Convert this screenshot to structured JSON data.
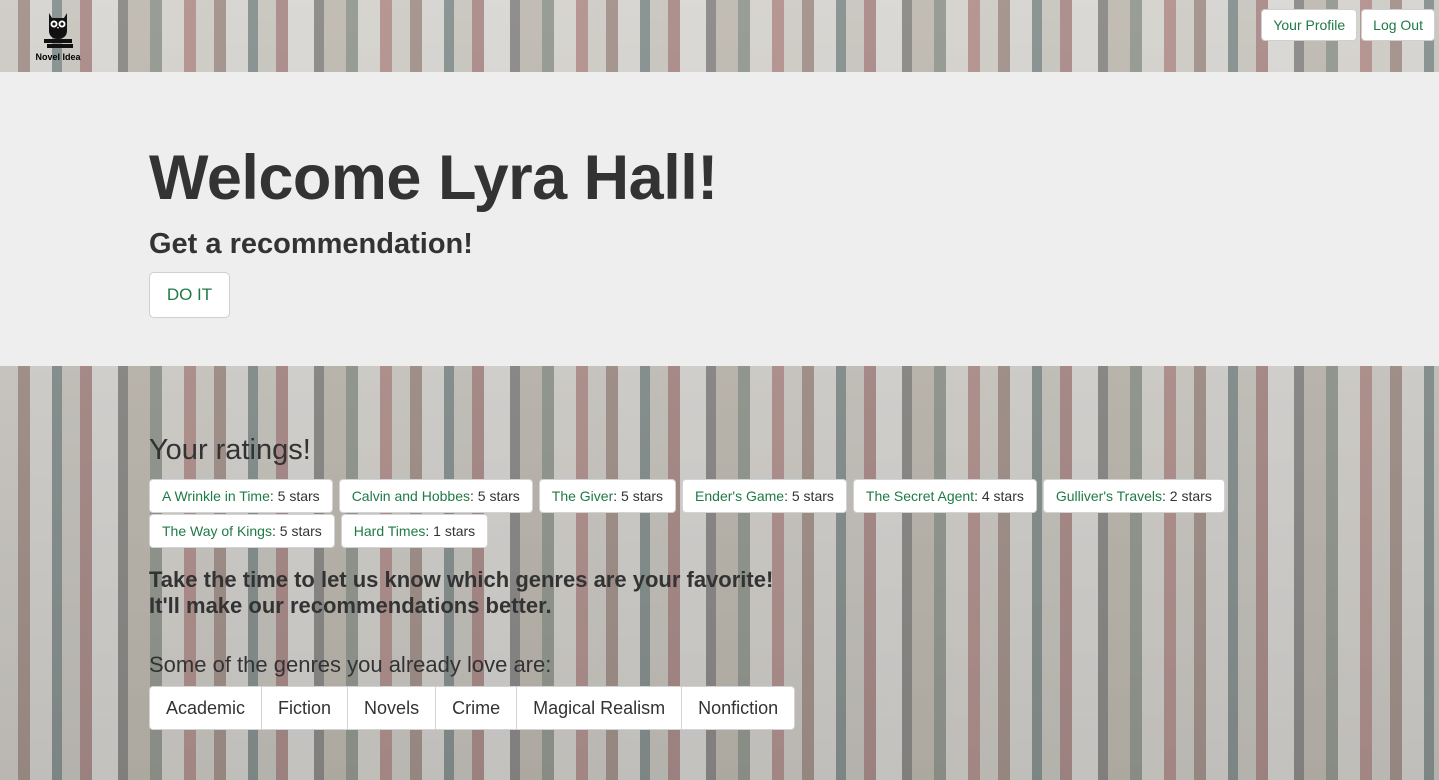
{
  "brand": {
    "name": "Novel Idea"
  },
  "topbar": {
    "profile_label": "Your Profile",
    "logout_label": "Log Out"
  },
  "jumbotron": {
    "welcome": "Welcome Lyra Hall!",
    "subhead": "Get a recommendation!",
    "doit_label": "DO IT"
  },
  "ratings": {
    "title": "Your ratings!",
    "items": [
      {
        "title": "A Wrinkle in Time",
        "stars": ": 5 stars"
      },
      {
        "title": "Calvin and Hobbes",
        "stars": ": 5 stars"
      },
      {
        "title": "The Giver",
        "stars": ": 5 stars"
      },
      {
        "title": "Ender's Game",
        "stars": ": 5 stars"
      },
      {
        "title": "The Secret Agent",
        "stars": ": 4 stars"
      },
      {
        "title": "Gulliver's Travels",
        "stars": ": 2 stars"
      },
      {
        "title": "The Way of Kings",
        "stars": ": 5 stars"
      },
      {
        "title": "Hard Times",
        "stars": ": 1 stars"
      }
    ]
  },
  "prompt": {
    "line1": "Take the time to let us know which genres are your favorite!",
    "line2": "It'll make our recommendations better."
  },
  "genres": {
    "title": "Some of the genres you already love are:",
    "items": [
      "Academic",
      "Fiction",
      "Novels",
      "Crime",
      "Magical Realism",
      "Nonfiction"
    ]
  },
  "colors": {
    "accent": "#1f7a45",
    "jumbotron_bg": "#eeeeee",
    "text": "#333333"
  },
  "icons": {
    "logo": "owl-on-books-icon"
  }
}
